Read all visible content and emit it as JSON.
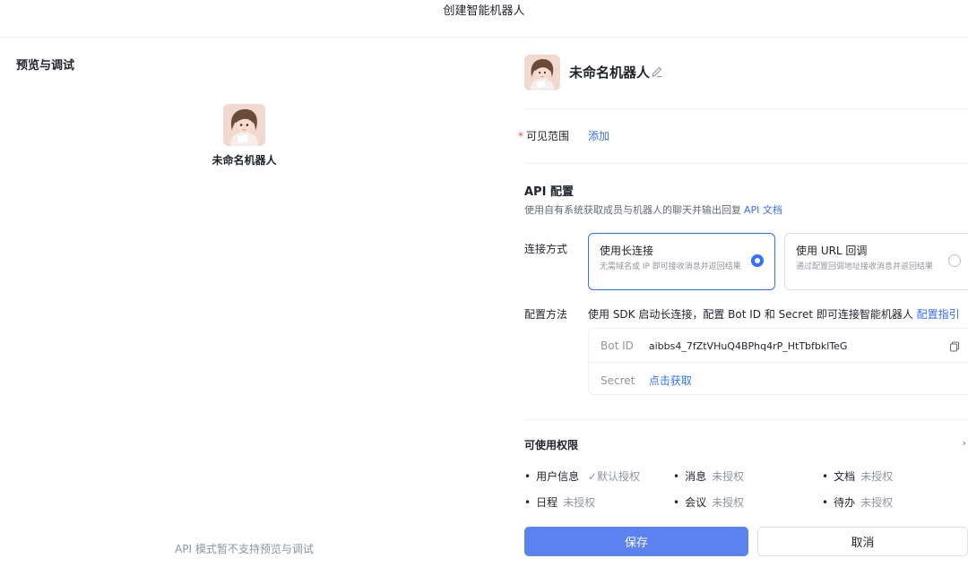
{
  "window": {
    "title": "创建智能机器人"
  },
  "preview": {
    "title": "预览与调试",
    "bot_name": "未命名机器人",
    "note": "API 模式暂不支持预览与调试"
  },
  "bot": {
    "name": "未命名机器人"
  },
  "visibility": {
    "label": "可见范围",
    "required_mark": "*",
    "add_link": "添加"
  },
  "api": {
    "title": "API 配置",
    "desc": "使用自有系统获取成员与机器人的聊天并输出回复",
    "doc_link": "API 文档",
    "connection": {
      "label": "连接方式",
      "options": [
        {
          "title": "使用长连接",
          "desc": "无需域名或 IP 即可接收消息并返回结果",
          "selected": true
        },
        {
          "title": "使用 URL 回调",
          "desc": "通过配置回调地址接收消息并返回结果",
          "selected": false
        }
      ]
    },
    "config": {
      "label": "配置方法",
      "desc": "使用 SDK 启动长连接，配置 Bot ID 和 Secret 即可连接智能机器人",
      "guide_link": "配置指引",
      "bot_id_key": "Bot ID",
      "bot_id_value": "aibbs4_7fZtVHuQ4BPhq4rP_HtTbfbklTeG",
      "secret_key": "Secret",
      "secret_link": "点击获取"
    }
  },
  "permissions": {
    "title": "可使用权限",
    "chevron": "›",
    "bullet": "•",
    "check_mark": "✓",
    "items": [
      {
        "name": "用户信息",
        "status": "默认授权"
      },
      {
        "name": "消息",
        "status": "未授权"
      },
      {
        "name": "文档",
        "status": "未授权"
      },
      {
        "name": "日程",
        "status": "未授权"
      },
      {
        "name": "会议",
        "status": "未授权"
      },
      {
        "name": "待办",
        "status": "未授权"
      }
    ]
  },
  "buttons": {
    "save": "保存",
    "cancel": "取消"
  },
  "colors": {
    "accent": "#3370ff",
    "save_button": "#5b82ee",
    "required": "#f54a45"
  },
  "icons": {
    "avatar": "girl-avatar-icon",
    "edit": "pencil-icon",
    "copy": "copy-icon"
  }
}
